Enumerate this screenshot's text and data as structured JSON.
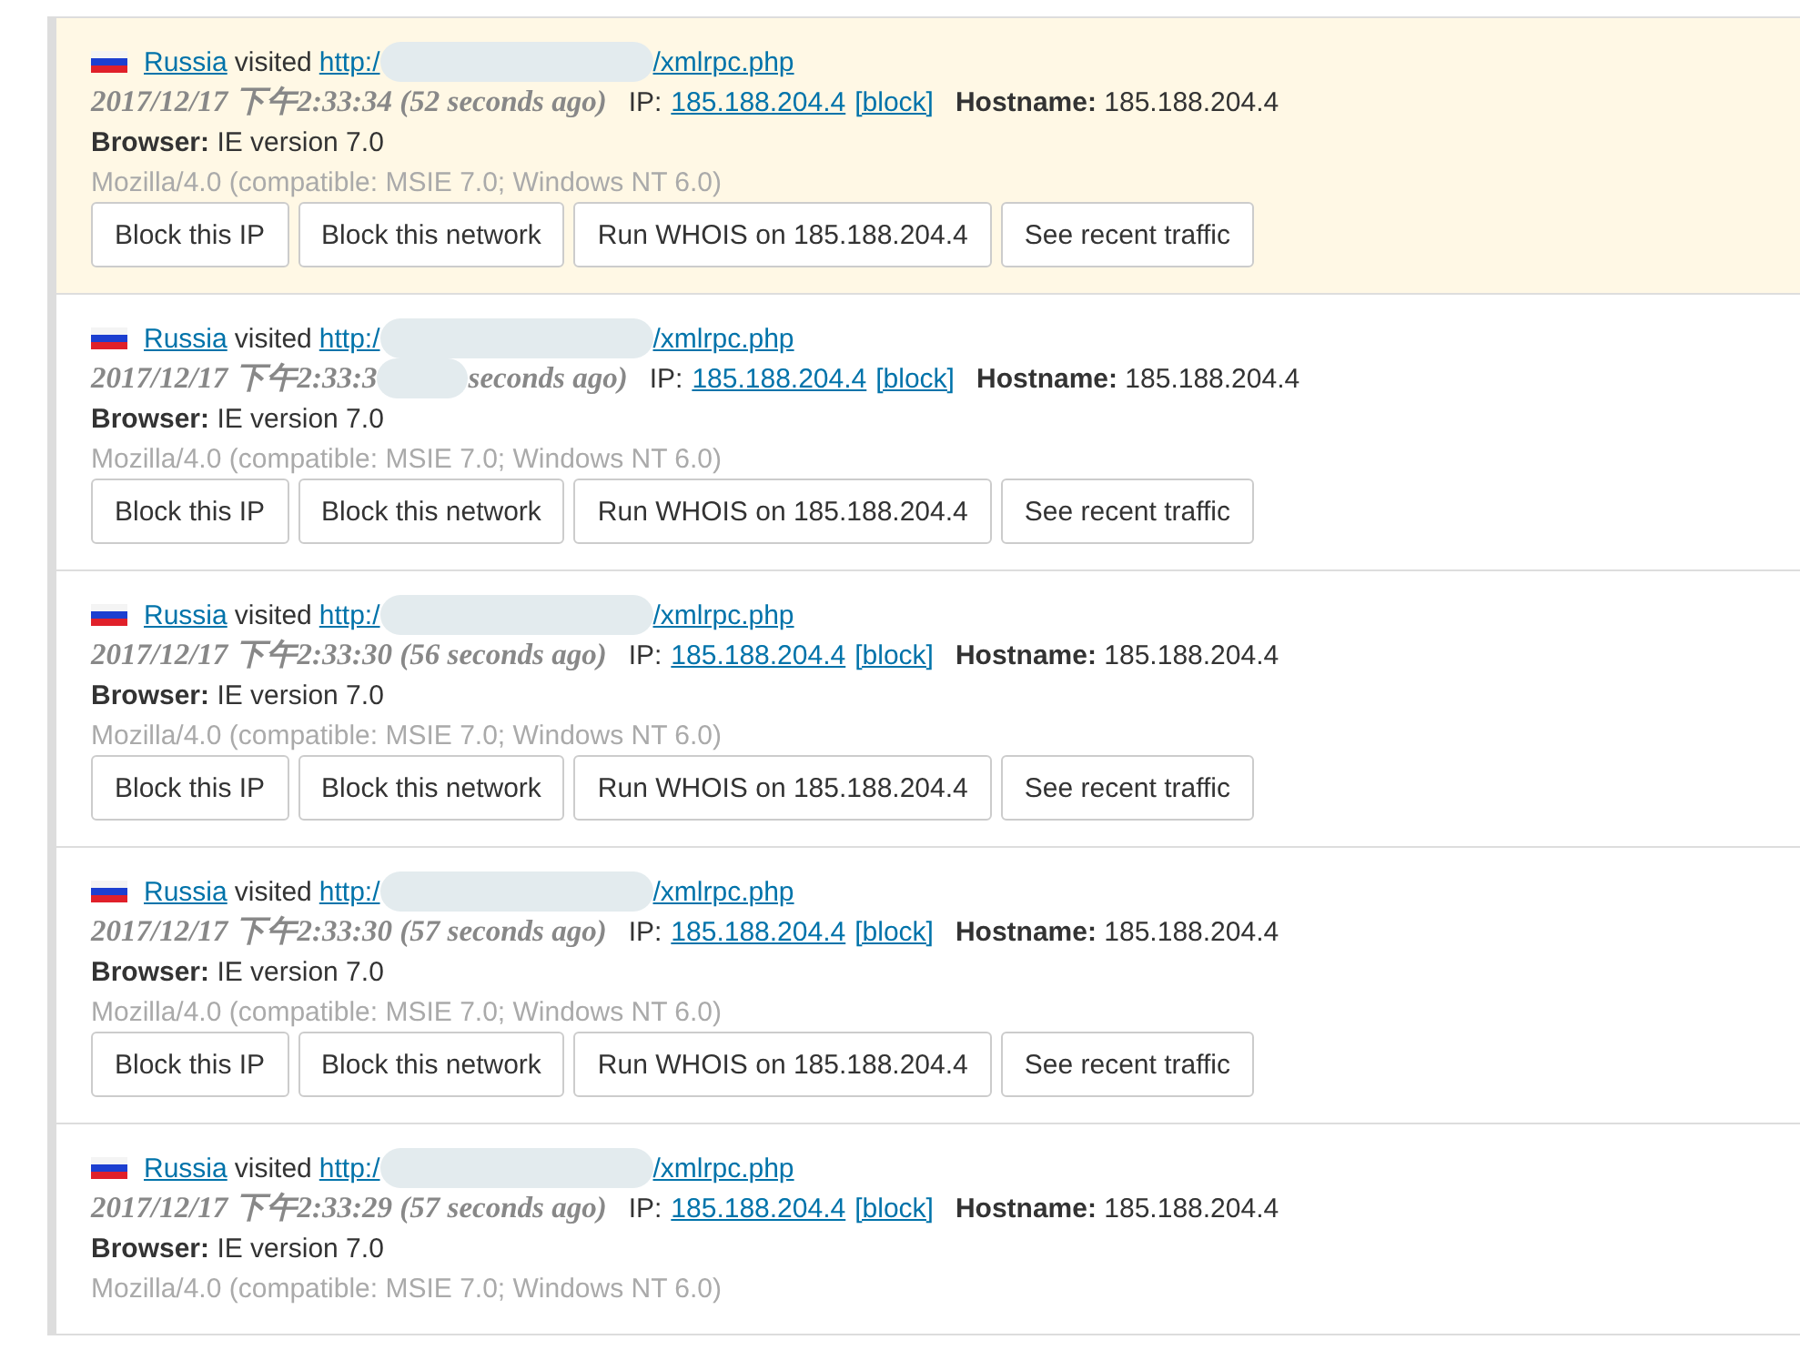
{
  "entries": [
    {
      "highlighted": true,
      "country": "Russia",
      "visited": "visited",
      "url_parts": [
        "http:/",
        "/xmlrpc.php"
      ],
      "time_parts": [
        "2017/12/17 下午2:33:34 (52 seconds ago)"
      ],
      "ip_label": "IP:",
      "ip": "185.188.204.4",
      "block_link": "[block]",
      "hostname": "**Hostname:** 185.188.204.4",
      "browser": "**Browser:** IE version 7.0",
      "user_agent": "Mozilla/4.0 (compatible: MSIE 7.0; Windows NT 6.0)",
      "buttons": [
        "Block this IP",
        "Block this network",
        "Run WHOIS on 185.188.204.4",
        "See recent traffic"
      ]
    },
    {
      "highlighted": false,
      "country": "Russia",
      "visited": "visited",
      "url_parts": [
        "http:/",
        "/xmlrpc.php"
      ],
      "time_parts": [
        "2017/12/17 下午2:33:3",
        "seconds ago)"
      ],
      "ip_label": "IP:",
      "ip": "185.188.204.4",
      "block_link": "[block]",
      "hostname": "**Hostname:** 185.188.204.4",
      "browser": "**Browser:** IE version 7.0",
      "user_agent": "Mozilla/4.0 (compatible: MSIE 7.0; Windows NT 6.0)",
      "buttons": [
        "Block this IP",
        "Block this network",
        "Run WHOIS on 185.188.204.4",
        "See recent traffic"
      ]
    },
    {
      "highlighted": false,
      "country": "Russia",
      "visited": "visited",
      "url_parts": [
        "http:/",
        "/xmlrpc.php"
      ],
      "time_parts": [
        "2017/12/17 下午2:33:30 (56 seconds ago)"
      ],
      "ip_label": "IP:",
      "ip": "185.188.204.4",
      "block_link": "[block]",
      "hostname": "**Hostname:** 185.188.204.4",
      "browser": "**Browser:** IE version 7.0",
      "user_agent": "Mozilla/4.0 (compatible: MSIE 7.0; Windows NT 6.0)",
      "buttons": [
        "Block this IP",
        "Block this network",
        "Run WHOIS on 185.188.204.4",
        "See recent traffic"
      ]
    },
    {
      "highlighted": false,
      "country": "Russia",
      "visited": "visited",
      "url_parts": [
        "http:/",
        "/xmlrpc.php"
      ],
      "time_parts": [
        "2017/12/17 下午2:33:30 (57 seconds ago)"
      ],
      "ip_label": "IP:",
      "ip": "185.188.204.4",
      "block_link": "[block]",
      "hostname": "**Hostname:** 185.188.204.4",
      "browser": "**Browser:** IE version 7.0",
      "user_agent": "Mozilla/4.0 (compatible: MSIE 7.0; Windows NT 6.0)",
      "buttons": [
        "Block this IP",
        "Block this network",
        "Run WHOIS on 185.188.204.4",
        "See recent traffic"
      ]
    },
    {
      "highlighted": false,
      "country": "Russia",
      "visited": "visited",
      "url_parts": [
        "http:/",
        "/xmlrpc.php"
      ],
      "time_parts": [
        "2017/12/17 下午2:33:29 (57 seconds ago)"
      ],
      "ip_label": "IP:",
      "ip": "185.188.204.4",
      "block_link": "[block]",
      "hostname": "**Hostname:** 185.188.204.4",
      "browser": "**Browser:** IE version 7.0",
      "user_agent": "Mozilla/4.0 (compatible: MSIE 7.0; Windows NT 6.0)"
    }
  ]
}
